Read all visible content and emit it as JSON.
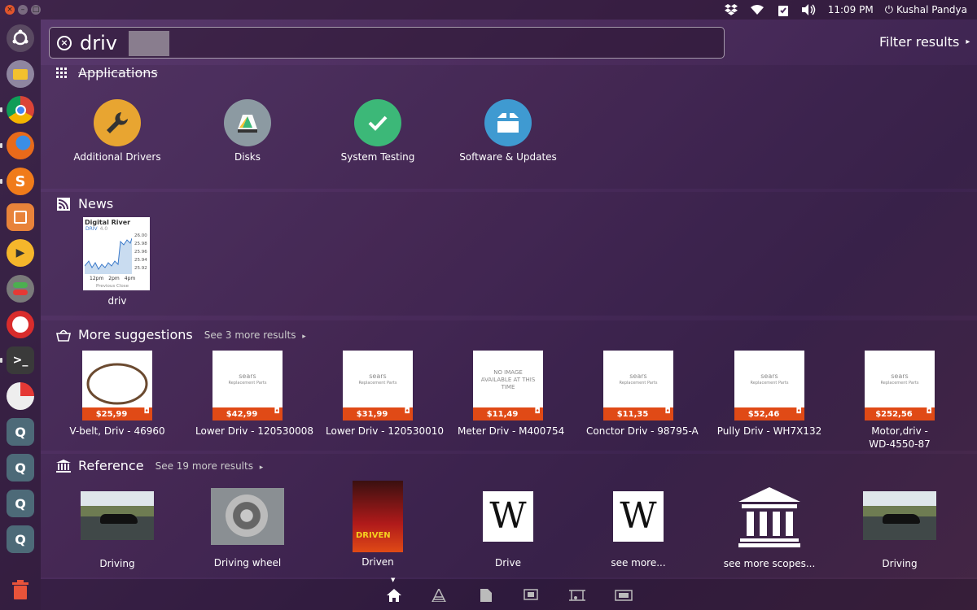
{
  "panel": {
    "dropbox_icon": "dropbox-icon",
    "wifi_icon": "wifi-icon",
    "clipboard_icon": "clipboard-icon",
    "volume_icon": "volume-icon",
    "time": "11:09 PM",
    "user": "Kushal Pandya"
  },
  "launcher": [
    "ubuntu-logo",
    "files",
    "chrome",
    "firefox",
    "sublime",
    "software-center",
    "player",
    "settings",
    "app",
    "terminal",
    "app2",
    "app3",
    "app4",
    "app5",
    "app6"
  ],
  "search": {
    "value": "driv"
  },
  "filter": {
    "label": "Filter results"
  },
  "applications": {
    "title": "Applications",
    "items": [
      {
        "label": "Additional Drivers",
        "icon": "wrench-icon",
        "color": "#e8a531"
      },
      {
        "label": "Disks",
        "icon": "disk-icon",
        "color": "#8c9aa2"
      },
      {
        "label": "System Testing",
        "icon": "check-icon",
        "color": "#3cb878"
      },
      {
        "label": "Software & Updates",
        "icon": "package-icon",
        "color": "#3f9ad1"
      }
    ]
  },
  "news": {
    "title": "News",
    "item": {
      "label": "driv",
      "thumb_title": "Digital River",
      "ticker": "DRIV",
      "ticker_value": "4.0",
      "prices": [
        "26.00",
        "25.98",
        "25.96",
        "25.94",
        "25.92"
      ],
      "times": [
        "12pm",
        "2pm",
        "4pm"
      ],
      "caption": "Previous Close"
    }
  },
  "suggestions": {
    "title": "More suggestions",
    "see_more": "See 3 more results",
    "items": [
      {
        "label": "V-belt, Driv - 46960",
        "price": "$25,99",
        "img": "belt"
      },
      {
        "label": "Lower Driv - 120530008",
        "price": "$42,99",
        "img": "sears"
      },
      {
        "label": "Lower Driv - 120530010",
        "price": "$31,99",
        "img": "sears"
      },
      {
        "label": "Meter Driv - M400754",
        "price": "$11,49",
        "img": "noimage"
      },
      {
        "label": "Conctor Driv - 98795-A",
        "price": "$11,35",
        "img": "sears"
      },
      {
        "label": "Pully Driv - WH7X132",
        "price": "$52,46",
        "img": "sears"
      },
      {
        "label": "Motor,driv -",
        "label2": "WD-4550-87",
        "price": "$252,56",
        "img": "sears"
      }
    ],
    "sears_text": "sears",
    "sears_sub": "Replacement Parts",
    "noimage_text": "NO IMAGE AVAILABLE AT THIS TIME"
  },
  "reference": {
    "title": "Reference",
    "see_more": "See 19 more results",
    "items": [
      {
        "label": "Driving",
        "img": "car"
      },
      {
        "label": "Driving wheel",
        "img": "wheel"
      },
      {
        "label": "Driven",
        "img": "poster"
      },
      {
        "label": "Drive",
        "img": "wikipedia"
      },
      {
        "label": "see more...",
        "img": "wikipedia"
      },
      {
        "label": "see more scopes...",
        "img": "museum"
      },
      {
        "label": "Driving",
        "img": "car"
      }
    ],
    "poster_text": "DRIVEN"
  },
  "lenses": [
    "home-icon",
    "applications-icon",
    "files-icon",
    "video-icon",
    "music-icon",
    "photos-icon"
  ]
}
